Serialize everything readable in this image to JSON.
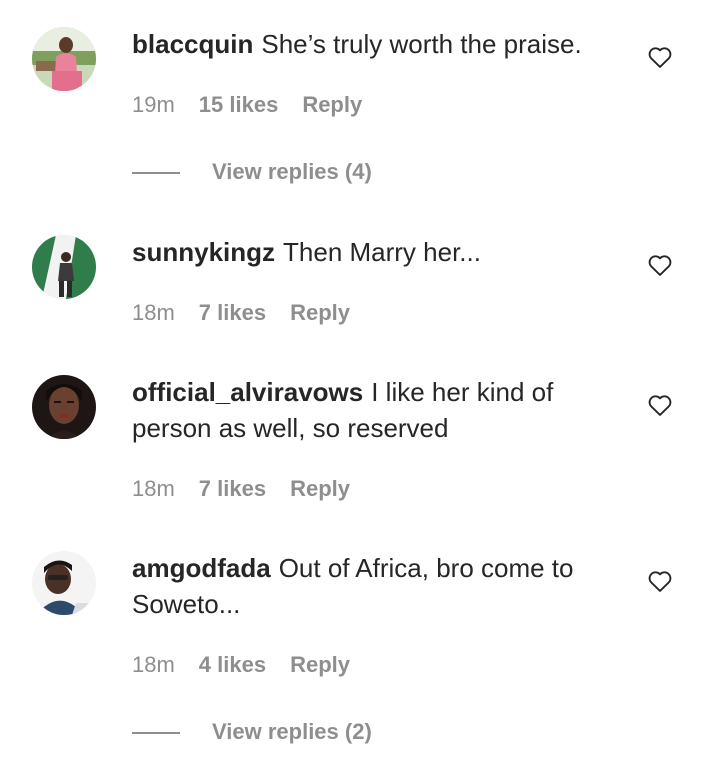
{
  "comments": [
    {
      "username": "blaccquin",
      "text": "She’s truly worth the praise.",
      "time": "19m",
      "likes": "15 likes",
      "reply": "Reply",
      "view_replies": "View replies (4)"
    },
    {
      "username": "sunnykingz",
      "text": "Then Marry her...",
      "time": "18m",
      "likes": "7 likes",
      "reply": "Reply"
    },
    {
      "username": "official_alviravows",
      "text": "I like her kind of person as well, so reserved",
      "time": "18m",
      "likes": "7 likes",
      "reply": "Reply"
    },
    {
      "username": "amgodfada",
      "text": "Out of Africa, bro come to Soweto...",
      "time": "18m",
      "likes": "4 likes",
      "reply": "Reply",
      "view_replies": "View replies (2)"
    }
  ],
  "icons": {
    "like": "heart-outline-icon",
    "line": "replies-divider-line"
  },
  "colors": {
    "text": "#262626",
    "muted": "#8e8e8e",
    "background": "#ffffff"
  }
}
